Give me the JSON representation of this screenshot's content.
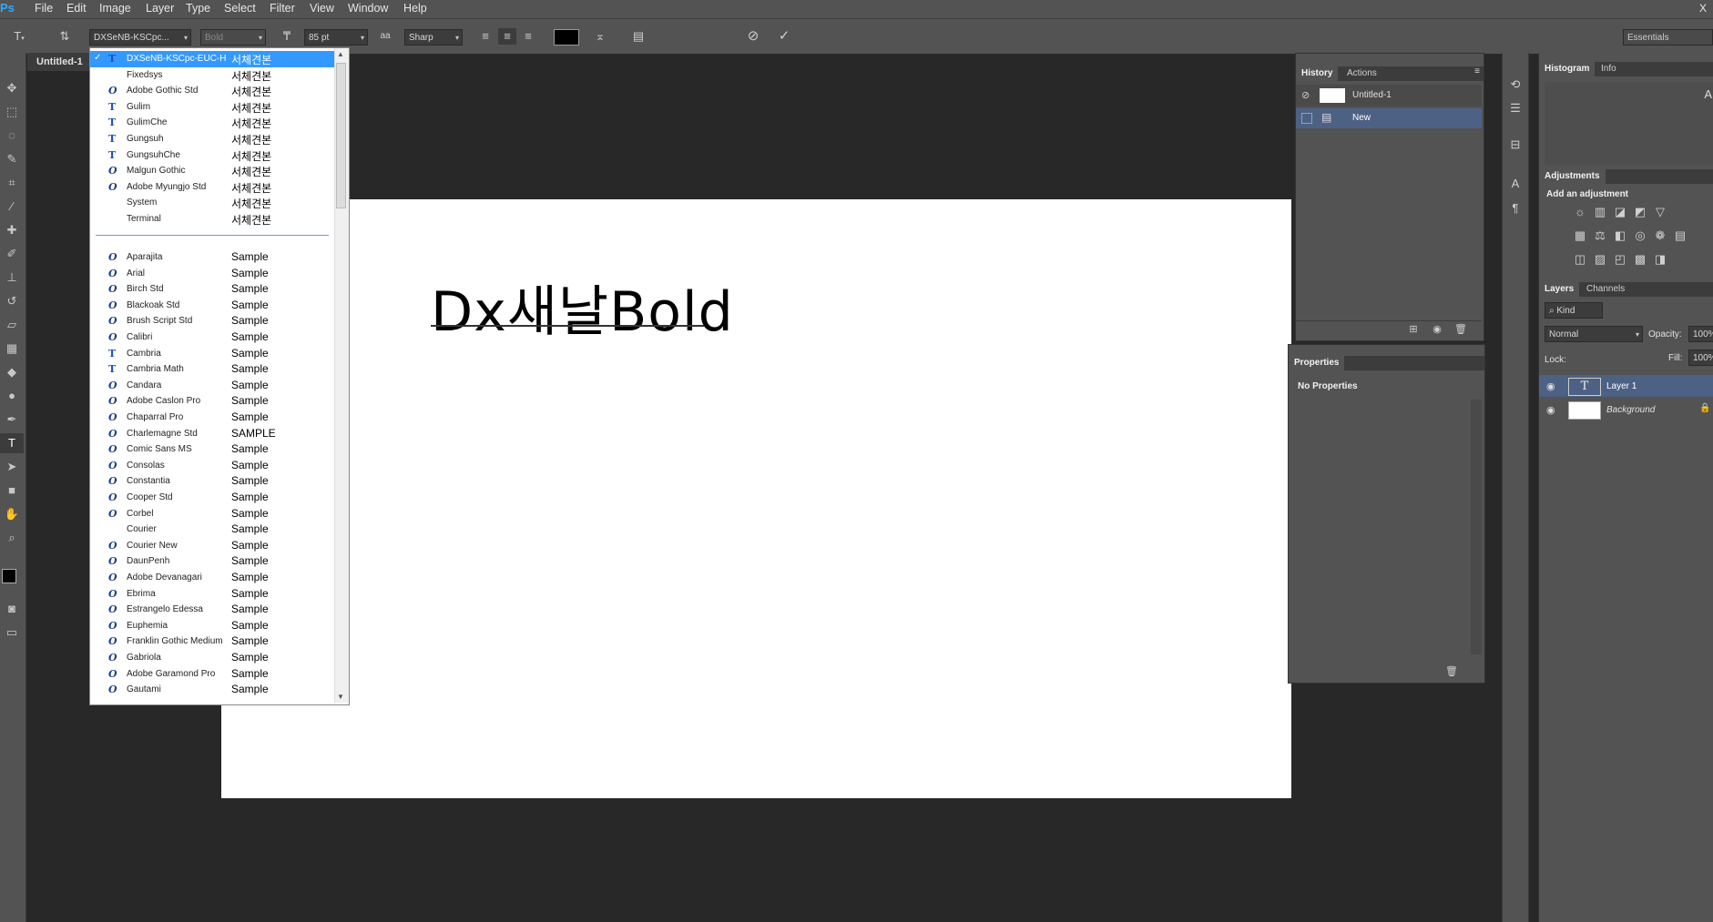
{
  "app": {
    "logo": "Ps"
  },
  "menu": [
    "File",
    "Edit",
    "Image",
    "Layer",
    "Type",
    "Select",
    "Filter",
    "View",
    "Window",
    "Help"
  ],
  "menu_right": "X",
  "options": {
    "font_family": "DXSeNB-KSCpc...",
    "font_style": "Bold",
    "font_size": "85 pt",
    "aa_icon": "aa",
    "antialias": "Sharp",
    "workspace": "Essentials"
  },
  "document": {
    "tab_title": "Untitled-1",
    "canvas_text": "Dx새날Bold"
  },
  "font_menu": {
    "top_items": [
      {
        "icon": "T",
        "type": "tt",
        "name": "DXSeNB-KSCpc-EUC-H",
        "sample": "서체견본",
        "selected": true
      },
      {
        "icon": "",
        "type": "none",
        "name": "Fixedsys",
        "sample": "서체견본"
      },
      {
        "icon": "O",
        "type": "ot",
        "name": "Adobe Gothic Std",
        "sample": "서체견본"
      },
      {
        "icon": "T",
        "type": "tt",
        "name": "Gulim",
        "sample": "서체견본"
      },
      {
        "icon": "T",
        "type": "tt",
        "name": "GulimChe",
        "sample": "서체견본"
      },
      {
        "icon": "T",
        "type": "tt",
        "name": "Gungsuh",
        "sample": "서체견본"
      },
      {
        "icon": "T",
        "type": "tt",
        "name": "GungsuhChe",
        "sample": "서체견본"
      },
      {
        "icon": "O",
        "type": "ot",
        "name": "Malgun Gothic",
        "sample": "서체견본"
      },
      {
        "icon": "O",
        "type": "ot",
        "name": "Adobe Myungjo Std",
        "sample": "서체견본"
      },
      {
        "icon": "",
        "type": "none",
        "name": "System",
        "sample": "서체견본"
      },
      {
        "icon": "",
        "type": "none",
        "name": "Terminal",
        "sample": "서체견본"
      }
    ],
    "items": [
      {
        "icon": "O",
        "type": "ot",
        "name": "Aparajita",
        "sample": "Sample"
      },
      {
        "icon": "O",
        "type": "ot",
        "name": "Arial",
        "sample": "Sample"
      },
      {
        "icon": "O",
        "type": "ot",
        "name": "Birch Std",
        "sample": "Sample"
      },
      {
        "icon": "O",
        "type": "ot",
        "name": "Blackoak Std",
        "sample": "Sample"
      },
      {
        "icon": "O",
        "type": "ot",
        "name": "Brush Script Std",
        "sample": "Sample"
      },
      {
        "icon": "O",
        "type": "ot",
        "name": "Calibri",
        "sample": "Sample"
      },
      {
        "icon": "T",
        "type": "tt",
        "name": "Cambria",
        "sample": "Sample"
      },
      {
        "icon": "T",
        "type": "tt",
        "name": "Cambria Math",
        "sample": "Sample"
      },
      {
        "icon": "O",
        "type": "ot",
        "name": "Candara",
        "sample": "Sample"
      },
      {
        "icon": "O",
        "type": "ot",
        "name": "Adobe Caslon Pro",
        "sample": "Sample"
      },
      {
        "icon": "O",
        "type": "ot",
        "name": "Chaparral Pro",
        "sample": "Sample"
      },
      {
        "icon": "O",
        "type": "ot",
        "name": "Charlemagne Std",
        "sample": "SAMPLE"
      },
      {
        "icon": "O",
        "type": "ot",
        "name": "Comic Sans MS",
        "sample": "Sample"
      },
      {
        "icon": "O",
        "type": "ot",
        "name": "Consolas",
        "sample": "Sample"
      },
      {
        "icon": "O",
        "type": "ot",
        "name": "Constantia",
        "sample": "Sample"
      },
      {
        "icon": "O",
        "type": "ot",
        "name": "Cooper Std",
        "sample": "Sample"
      },
      {
        "icon": "O",
        "type": "ot",
        "name": "Corbel",
        "sample": "Sample"
      },
      {
        "icon": "",
        "type": "none",
        "name": "Courier",
        "sample": "Sample"
      },
      {
        "icon": "O",
        "type": "ot",
        "name": "Courier New",
        "sample": "Sample"
      },
      {
        "icon": "O",
        "type": "ot",
        "name": "DaunPenh",
        "sample": "Sample"
      },
      {
        "icon": "O",
        "type": "ot",
        "name": "Adobe Devanagari",
        "sample": "Sample"
      },
      {
        "icon": "O",
        "type": "ot",
        "name": "Ebrima",
        "sample": "Sample"
      },
      {
        "icon": "O",
        "type": "ot",
        "name": "Estrangelo Edessa",
        "sample": "Sample"
      },
      {
        "icon": "O",
        "type": "ot",
        "name": "Euphemia",
        "sample": "Sample"
      },
      {
        "icon": "O",
        "type": "ot",
        "name": "Franklin Gothic Medium",
        "sample": "Sample"
      },
      {
        "icon": "O",
        "type": "ot",
        "name": "Gabriola",
        "sample": "Sample"
      },
      {
        "icon": "O",
        "type": "ot",
        "name": "Adobe Garamond Pro",
        "sample": "Sample"
      },
      {
        "icon": "O",
        "type": "ot",
        "name": "Gautami",
        "sample": "Sample"
      }
    ]
  },
  "history": {
    "tabs": [
      "History",
      "Actions"
    ],
    "snapshot": "Untitled-1",
    "items": [
      "New"
    ]
  },
  "properties": {
    "title": "Properties",
    "empty": "No Properties"
  },
  "histogram": {
    "tabs": [
      "Histogram",
      "Info"
    ],
    "corner": "A"
  },
  "adjustments": {
    "title": "Adjustments",
    "subtitle": "Add an adjustment"
  },
  "layers": {
    "tabs": [
      "Layers",
      "Channels"
    ],
    "kind": "Kind",
    "blend_mode": "Normal",
    "opacity_label": "Opacity:",
    "opacity": "100%",
    "lock_label": "Lock:",
    "fill_label": "Fill:",
    "fill": "100%",
    "items": [
      {
        "name": "Layer 1",
        "thumb": "T",
        "selected": true
      },
      {
        "name": "Background",
        "thumb": "",
        "selected": false
      }
    ]
  }
}
